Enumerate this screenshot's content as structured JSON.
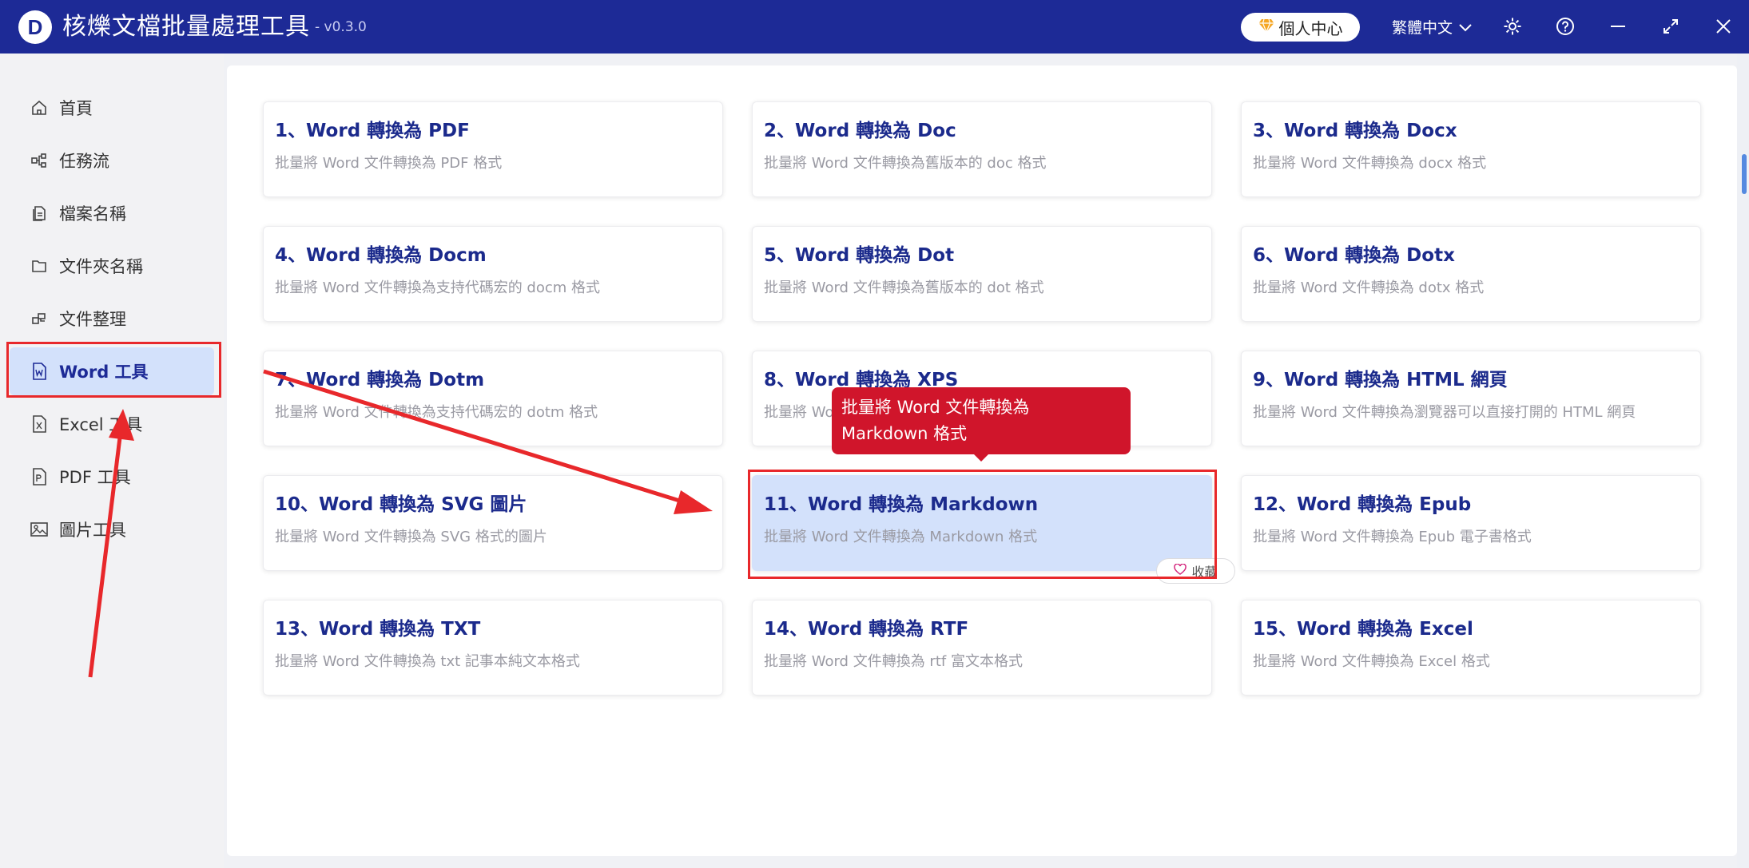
{
  "app": {
    "title": "核爍文檔批量處理工具",
    "version": "- v0.3.0",
    "logo_letter": "D",
    "user_center": "個人中心",
    "language": "繁體中文"
  },
  "icons": {
    "user_center": "diamond-icon",
    "settings": "gear-icon",
    "help": "question-icon",
    "minimize": "minimize-icon",
    "maximize": "maximize-icon",
    "close": "close-icon"
  },
  "colors": {
    "titlebar": "#1d2a96",
    "accent": "#1b2a8c",
    "highlight": "#d3e1fb",
    "tooltip": "#d0152b",
    "annotation": "#e8282b"
  },
  "sidebar": {
    "items": [
      {
        "label": "首頁",
        "icon": "home-icon"
      },
      {
        "label": "任務流",
        "icon": "workflow-icon"
      },
      {
        "label": "檔案名稱",
        "icon": "file-icon"
      },
      {
        "label": "文件夾名稱",
        "icon": "folder-icon"
      },
      {
        "label": "文件整理",
        "icon": "organize-icon"
      },
      {
        "label": "Word 工具",
        "icon": "word-icon",
        "active": true
      },
      {
        "label": "Excel 工具",
        "icon": "excel-icon"
      },
      {
        "label": "PDF 工具",
        "icon": "pdf-icon"
      },
      {
        "label": "圖片工具",
        "icon": "image-icon"
      }
    ]
  },
  "tools": [
    {
      "title": "1、Word 轉換為 PDF",
      "desc": "批量將 Word 文件轉換為 PDF 格式"
    },
    {
      "title": "2、Word 轉換為 Doc",
      "desc": "批量將 Word 文件轉換為舊版本的 doc 格式"
    },
    {
      "title": "3、Word 轉換為 Docx",
      "desc": "批量將 Word 文件轉換為 docx 格式"
    },
    {
      "title": "4、Word 轉換為 Docm",
      "desc": "批量將 Word 文件轉換為支持代碼宏的 docm 格式"
    },
    {
      "title": "5、Word 轉換為 Dot",
      "desc": "批量將 Word 文件轉換為舊版本的 dot 格式"
    },
    {
      "title": "6、Word 轉換為 Dotx",
      "desc": "批量將 Word 文件轉換為 dotx 格式"
    },
    {
      "title": "7、Word 轉換為 Dotm",
      "desc": "批量將 Word 文件轉換為支持代碼宏的 dotm 格式"
    },
    {
      "title": "8、Word 轉換為 XPS",
      "desc": "批量將 Word 文件轉換為 XPS 格式"
    },
    {
      "title": "9、Word 轉換為 HTML 網頁",
      "desc": "批量將 Word 文件轉換為瀏覽器可以直接打開的 HTML 網頁"
    },
    {
      "title": "10、Word 轉換為 SVG 圖片",
      "desc": "批量將 Word 文件轉換為 SVG 格式的圖片"
    },
    {
      "title": "11、Word 轉換為 Markdown",
      "desc": "批量將 Word 文件轉換為 Markdown 格式",
      "highlighted": true
    },
    {
      "title": "12、Word 轉換為 Epub",
      "desc": "批量將 Word 文件轉換為 Epub 電子書格式"
    },
    {
      "title": "13、Word 轉換為 TXT",
      "desc": "批量將 Word 文件轉換為 txt 記事本純文本格式"
    },
    {
      "title": "14、Word 轉換為 RTF",
      "desc": "批量將 Word 文件轉換為 rtf 富文本格式"
    },
    {
      "title": "15、Word 轉換為 Excel",
      "desc": "批量將 Word 文件轉換為 Excel 格式"
    }
  ],
  "tooltip": {
    "text": "批量將 Word 文件轉換為 Markdown 格式"
  },
  "favorite": {
    "label": "收藏",
    "icon": "heart-icon"
  }
}
